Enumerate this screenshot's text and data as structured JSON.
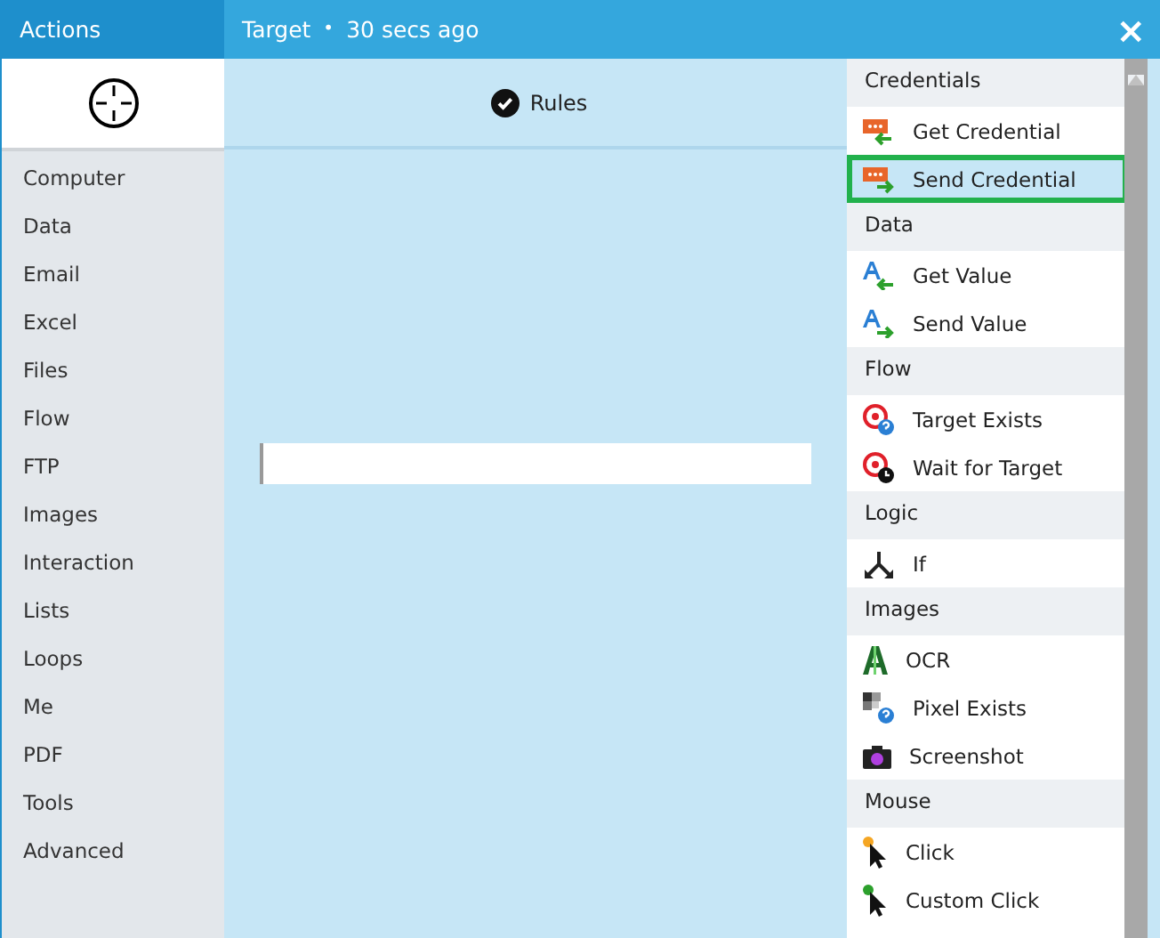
{
  "left_header": {
    "title": "Actions"
  },
  "main_header": {
    "title": "Target",
    "separator": "•",
    "time": "30 secs ago",
    "close": "×"
  },
  "categories": [
    "Computer",
    "Data",
    "Email",
    "Excel",
    "Files",
    "Flow",
    "FTP",
    "Images",
    "Interaction",
    "Lists",
    "Loops",
    "Me",
    "PDF",
    "Tools",
    "Advanced"
  ],
  "tabs": [
    {
      "label": "Rules",
      "selected": true
    }
  ],
  "sections": [
    {
      "title": "Credentials",
      "items": [
        {
          "label": "Get Credential",
          "selected": false
        },
        {
          "label": "Send Credential",
          "selected": true
        }
      ]
    },
    {
      "title": "Data",
      "items": [
        {
          "label": "Get Value",
          "selected": false
        },
        {
          "label": "Send Value",
          "selected": false
        }
      ]
    },
    {
      "title": "Flow",
      "items": [
        {
          "label": "Target Exists",
          "selected": false
        },
        {
          "label": "Wait for Target",
          "selected": false
        }
      ]
    },
    {
      "title": "Logic",
      "items": [
        {
          "label": "If",
          "selected": false
        }
      ]
    },
    {
      "title": "Images",
      "items": [
        {
          "label": "OCR",
          "selected": false
        },
        {
          "label": "Pixel Exists",
          "selected": false
        },
        {
          "label": "Screenshot",
          "selected": false
        }
      ]
    },
    {
      "title": "Mouse",
      "items": [
        {
          "label": "Click",
          "selected": false
        },
        {
          "label": "Custom Click",
          "selected": false
        }
      ]
    }
  ]
}
